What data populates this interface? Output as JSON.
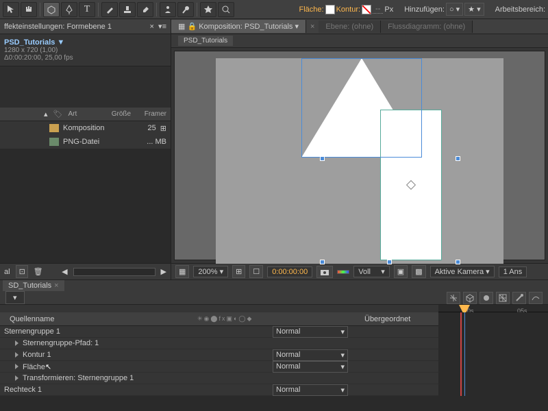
{
  "option_bar": {
    "fill_label": "Fläche:",
    "stroke_label": "Kontur:",
    "px_label": "Px",
    "add_label": "Hinzufügen:",
    "workspace_label": "Arbeitsbereich:"
  },
  "panels": {
    "effect_tab": "ffekteinstellungen: Formebene 1",
    "comp_tab_prefix": "Komposition:",
    "comp_name": "PSD_Tutorials",
    "layer_tab": "Ebene: (ohne)",
    "flow_tab": "Flussdiagramm: (ohne)"
  },
  "project": {
    "name": "PSD_Tutorials ▼",
    "size": "1280 x 720 (1,00)",
    "duration": "Δ0:00:20:00, 25,00 fps",
    "headers": {
      "type": "Art",
      "size": "Größe",
      "fr": "Framer"
    },
    "rows": [
      {
        "type": "Komposition",
        "size": "",
        "fr": "25"
      },
      {
        "type": "PNG-Datei",
        "size": "... MB",
        "fr": ""
      }
    ],
    "footer_label": "al"
  },
  "viewer": {
    "zoom": "200%",
    "time": "0:00:00:00",
    "view_mode": "Voll",
    "camera": "Aktive Kamera",
    "views": "1 Ans"
  },
  "timeline": {
    "tab": "SD_Tutorials",
    "ruler_label": "0s",
    "ruler_label2": "05s",
    "col_source": "Quellenname",
    "col_parent": "Übergeordnet",
    "layers": [
      {
        "name": "Sternengruppe 1",
        "mode": "Normal",
        "indent": 0,
        "tri": false
      },
      {
        "name": "Sternengruppe-Pfad: 1",
        "mode": "",
        "indent": 1,
        "tri": true
      },
      {
        "name": "Kontur 1",
        "mode": "Normal",
        "indent": 1,
        "tri": true
      },
      {
        "name": "Fläche",
        "mode": "Normal",
        "indent": 1,
        "tri": true,
        "cursor": true
      },
      {
        "name": "Transformieren: Sternengruppe 1",
        "mode": "",
        "indent": 1,
        "tri": true
      },
      {
        "name": "Rechteck 1",
        "mode": "Normal",
        "indent": 0,
        "tri": false
      }
    ]
  }
}
